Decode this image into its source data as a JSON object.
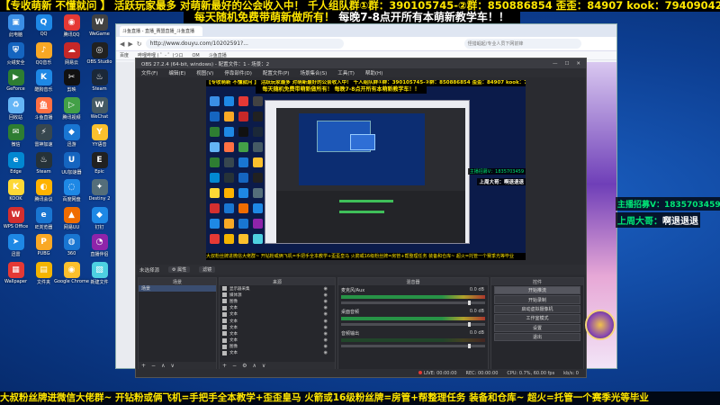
{
  "banner": {
    "top_line": "【专收萌新 不懂就问 】 活跃玩家最多 对萌新最好的公会收入中！ 千人组队群①群：390105745-②群：850886854 歪歪：84907 kook：79409042",
    "second_line_a": "每天随机免费带萌新做所有！",
    "second_line_b": "每晚7-8点开所有本萌新教学车！！"
  },
  "promo": {
    "line1": "主播招募V：1835703459",
    "line2_prefix": "上周大哥：",
    "line2_name": "啊退退退"
  },
  "marquee": {
    "text": "大叔粉丝牌进微信大佬群~ 开钻粉或俩飞机=手把手全本教学+歪歪皇马   火箭或16级粉丝牌=房管+帮整理任务 装备和仓库~   超火=托管一个赛季光等毕业"
  },
  "desktop_icons": [
    {
      "label": "此电脑",
      "glyph": "▣",
      "color": "#3a8ee6"
    },
    {
      "label": "QQ",
      "glyph": "Q",
      "color": "#1e88e5"
    },
    {
      "label": "腾讯QQ",
      "glyph": "◉",
      "color": "#e53935"
    },
    {
      "label": "WeGame",
      "glyph": "W",
      "color": "#424242"
    },
    {
      "label": "火绒安全",
      "glyph": "⛨",
      "color": "#1565c0"
    },
    {
      "label": "QQ音乐",
      "glyph": "♪",
      "color": "#f9a825"
    },
    {
      "label": "网易云",
      "glyph": "☁",
      "color": "#c62828"
    },
    {
      "label": "OBS Studio",
      "glyph": "◎",
      "color": "#212121"
    },
    {
      "label": "GeForce",
      "glyph": "▶",
      "color": "#2e7d32"
    },
    {
      "label": "酷狗音乐",
      "glyph": "K",
      "color": "#1e88e5"
    },
    {
      "label": "剪映",
      "glyph": "✂",
      "color": "#111111"
    },
    {
      "label": "Steam",
      "glyph": "♨",
      "color": "#1b2838"
    },
    {
      "label": "回收站",
      "glyph": "♻",
      "color": "#64b5f6"
    },
    {
      "label": "斗鱼直播",
      "glyph": "鱼",
      "color": "#ff7043"
    },
    {
      "label": "腾讯视频",
      "glyph": "▷",
      "color": "#43a047"
    },
    {
      "label": "WeChat",
      "glyph": "W",
      "color": "#455a64"
    },
    {
      "label": "微信",
      "glyph": "✉",
      "color": "#2e7d32"
    },
    {
      "label": "雷神加速",
      "glyph": "⚡",
      "color": "#37474f"
    },
    {
      "label": "迅游",
      "glyph": "◆",
      "color": "#1976d2"
    },
    {
      "label": "YY语音",
      "glyph": "Y",
      "color": "#fbc02d"
    },
    {
      "label": "Edge",
      "glyph": "e",
      "color": "#0288d1"
    },
    {
      "label": "Steam",
      "glyph": "♨",
      "color": "#263238"
    },
    {
      "label": "UU加速器",
      "glyph": "U",
      "color": "#1565c0"
    },
    {
      "label": "Epic",
      "glyph": "E",
      "color": "#212121"
    },
    {
      "label": "KOOK",
      "glyph": "K",
      "color": "#fdd835"
    },
    {
      "label": "腾讯会议",
      "glyph": "◐",
      "color": "#ffb300"
    },
    {
      "label": "百度网盘",
      "glyph": "◌",
      "color": "#1e88e5"
    },
    {
      "label": "Destiny 2",
      "glyph": "✦",
      "color": "#546e7a"
    },
    {
      "label": "WPS Office",
      "glyph": "W",
      "color": "#d32f2f"
    },
    {
      "label": "IE浏览器",
      "glyph": "e",
      "color": "#1976d2"
    },
    {
      "label": "网易UU",
      "glyph": "▲",
      "color": "#ef6c00"
    },
    {
      "label": "钉钉",
      "glyph": "◆",
      "color": "#1e88e5"
    },
    {
      "label": "迅雷",
      "glyph": "➤",
      "color": "#1e88e5"
    },
    {
      "label": "PUBG",
      "glyph": "P",
      "color": "#f9a825"
    },
    {
      "label": "360",
      "glyph": "◍",
      "color": "#1976d2"
    },
    {
      "label": "直播伴侣",
      "glyph": "◔",
      "color": "#8e24aa"
    },
    {
      "label": "Wallpaper",
      "glyph": "▦",
      "color": "#e53935"
    },
    {
      "label": "文件夹",
      "glyph": "▤",
      "color": "#f4b400"
    },
    {
      "label": "Google Chrome",
      "glyph": "◉",
      "color": "#fbc02d"
    },
    {
      "label": "新建文件",
      "glyph": "▧",
      "color": "#4dd0e1"
    }
  ],
  "browser": {
    "tab_label": "斗鱼直播 - 直播_赛盟直播_斗鱼直播",
    "url": "http://www.douyu.com/10202591?...",
    "search_placeholder": "怪猎崛起/专业人员下网前锋",
    "bookmarks": [
      "百度",
      "哔哩哔哩 ( ゜- ゜)つロ",
      "OM",
      "斗鱼直播"
    ]
  },
  "obs": {
    "title": "OBS 27.2.4 (64-bit, windows) - 配置文件：1 - 场景：2",
    "menu": [
      "文件(F)",
      "编辑(E)",
      "视图(V)",
      "停靠部件(D)",
      "配置文件(P)",
      "场景集合(S)",
      "工具(T)",
      "帮助(H)"
    ],
    "window_buttons": [
      "—",
      "☐",
      "✕"
    ],
    "no_source_text": "未选择源",
    "properties_label": "⚙ 属性",
    "filters_label": "滤镜",
    "panels": {
      "scenes": "场景",
      "sources": "来源",
      "mixer": "混音器",
      "controls": "控件"
    },
    "scenes": [
      "场景"
    ],
    "sources": [
      "显示器采集",
      "媒体源",
      "图像",
      "文本",
      "文本",
      "文本",
      "文本",
      "文本",
      "文本",
      "图像",
      "文本"
    ],
    "mixer": [
      {
        "name": "麦克风/Aux",
        "db": "0.0 dB",
        "active": true
      },
      {
        "name": "桌面音频",
        "db": "0.0 dB",
        "active": true
      },
      {
        "name": "音频输出",
        "db": "0.0 dB",
        "active": false
      }
    ],
    "controls": [
      "开始推流",
      "开始录制",
      "启动虚拟摄像机",
      "工作室模式",
      "设置",
      "退出"
    ],
    "status": {
      "live": "LIVE: 00:00:00",
      "rec": "REC: 00:00:00",
      "cpu": "CPU: 0.7%, 60.00 fps",
      "kbps": "kb/s: 0"
    },
    "preview_banner_a": "【专收萌新 不懂就问 】 活跃玩家最多 对萌新最好的公会收入中！ 千人组队群①群：390105745-②群：850886854 歪歪：84907 kook：79409042",
    "preview_banner_b": "每天随机免费带萌新做所有！ 每晚7-8点开所有本萌新教学车！！",
    "preview_promo1": "主播招募V：1835703459",
    "preview_promo2": "上周大哥：啊退退退",
    "preview_marquee": "大叔粉丝牌进微信大佬群~ 开钻粉或俩飞机=手把手全本教学+歪歪皇马   火箭或16级粉丝牌=房管+帮整理任务 装备和仓库~   超火=托管一个赛季光等毕业"
  },
  "colors": {
    "banner_yellow": "#ffe600",
    "promo_green": "#00e676",
    "desktop_blue": "#0d3f93",
    "obs_bg": "#2a2b30"
  }
}
